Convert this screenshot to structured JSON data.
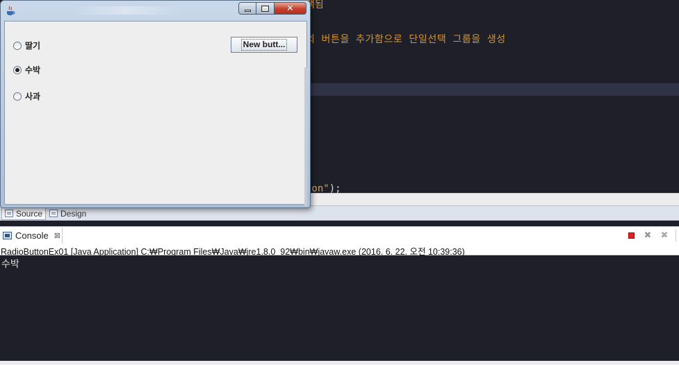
{
  "editor": {
    "top_line": "택됨",
    "comment_line": "의 버튼을 추가함으로 단일선택 그룹을 생성",
    "string_part": "ton\"",
    "string_punct": ");"
  },
  "editor_tabs": [
    {
      "label": "Source",
      "icon": "source-icon"
    },
    {
      "label": "Design",
      "icon": "design-icon"
    }
  ],
  "app_window": {
    "icon": "java-icon",
    "radios": [
      {
        "label": "딸기",
        "checked": false
      },
      {
        "label": "수박",
        "checked": true
      },
      {
        "label": "사과",
        "checked": false
      }
    ],
    "new_button_label": "New butt..."
  },
  "console": {
    "tab_label": "Console",
    "tab_close": "⊠",
    "path_text": "RadioButtonEx01 [Java Application] C:₩Program Files₩Java₩jre1.8.0_92₩bin₩javaw.exe (2016. 6. 22. 오전 10:39:36)",
    "output": "수박",
    "tools": [
      "terminate-icon",
      "remove-launch-icon",
      "remove-all-icon"
    ]
  },
  "colors": {
    "editor_bg": "#1e1f28",
    "comment_orange": "#d4942f",
    "terminate_red": "#dd2222",
    "close_red": "#c6402b"
  }
}
